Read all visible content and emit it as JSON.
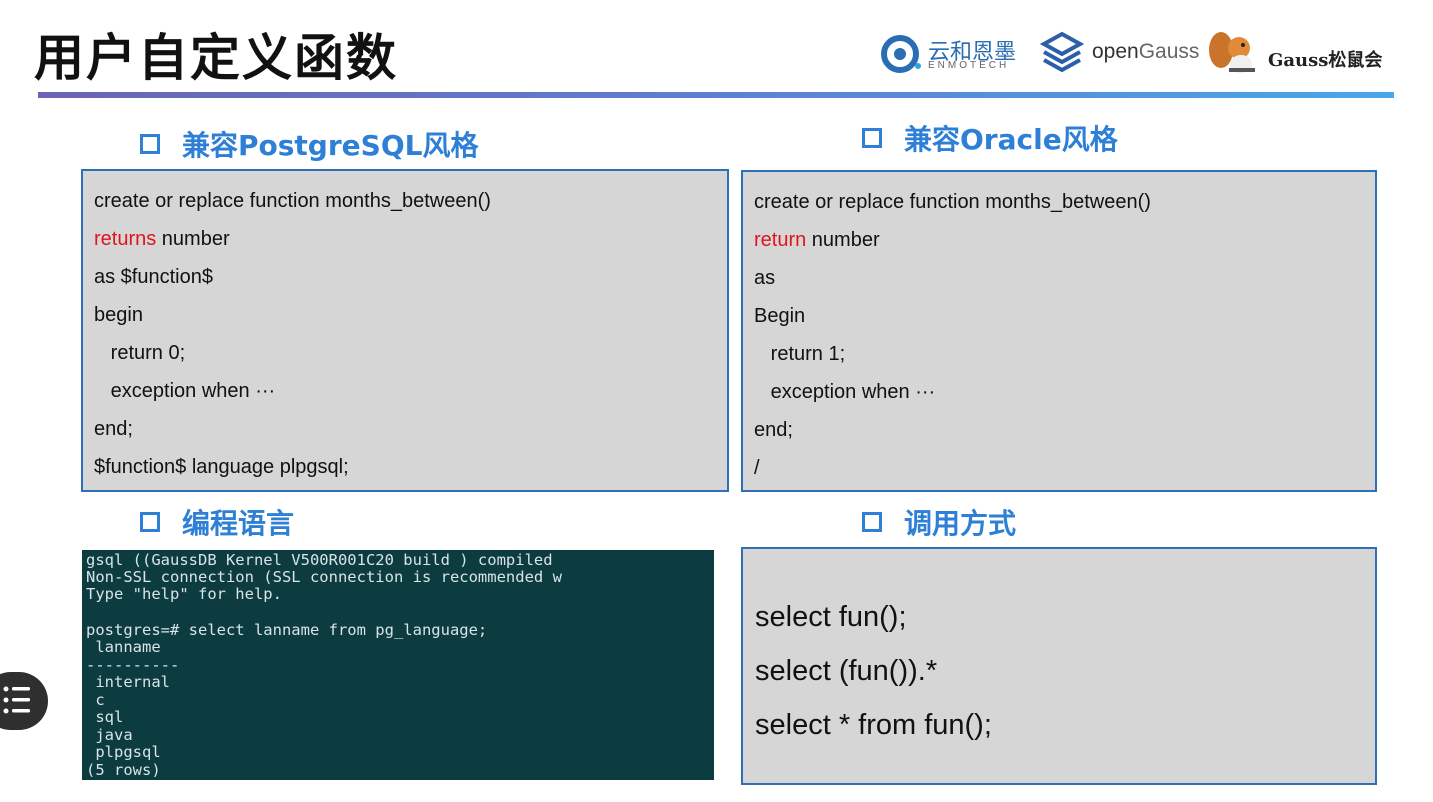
{
  "title": "用户自定义函数",
  "logos": {
    "enmotech_cn": "云和恩墨",
    "enmotech_en": "ENMOTECH",
    "opengauss_open": "open",
    "opengauss_gauss": "Gauss",
    "gauss_club": "Gauss松鼠会"
  },
  "sections": {
    "postgres_head": "兼容PostgreSQL风格",
    "oracle_head": "兼容Oracle风格",
    "language_head": "编程语言",
    "call_head": "调用方式"
  },
  "postgres_code": {
    "l1": "create or replace function months_between()",
    "l2_kw": "returns",
    "l2_rest": " number",
    "l3": "as $function$",
    "l4": "begin",
    "l5": "   return 0;",
    "l6": "   exception when ···",
    "l7": "end;",
    "l8": "$function$ language plpgsql;"
  },
  "oracle_code": {
    "l1": "create or replace function months_between()",
    "l2_kw": "return",
    "l2_rest": " number",
    "l3": "as",
    "l4": "Begin",
    "l5": "   return 1;",
    "l6": "   exception when ···",
    "l7": "end;",
    "l8": "/"
  },
  "terminal": {
    "l1": "gsql ((GaussDB Kernel V500R001C20 build ) compiled",
    "l2": "Non-SSL connection (SSL connection is recommended w",
    "l3": "Type \"help\" for help.",
    "l4": "postgres=# select lanname from pg_language;",
    "l5": " lanname",
    "l6": "----------",
    "l7": " internal",
    "l8": " c",
    "l9": " sql",
    "l10": " java",
    "l11": " plpgsql",
    "l12": "(5 rows)"
  },
  "calls": {
    "c1": "select fun();",
    "c2": "select (fun()).*",
    "c3": "select * from fun();"
  },
  "colors": {
    "accent_blue": "#2e7fd6",
    "keyword_red": "#e0141e",
    "code_bg": "#d6d6d6",
    "terminal_bg": "#0c3b40"
  }
}
